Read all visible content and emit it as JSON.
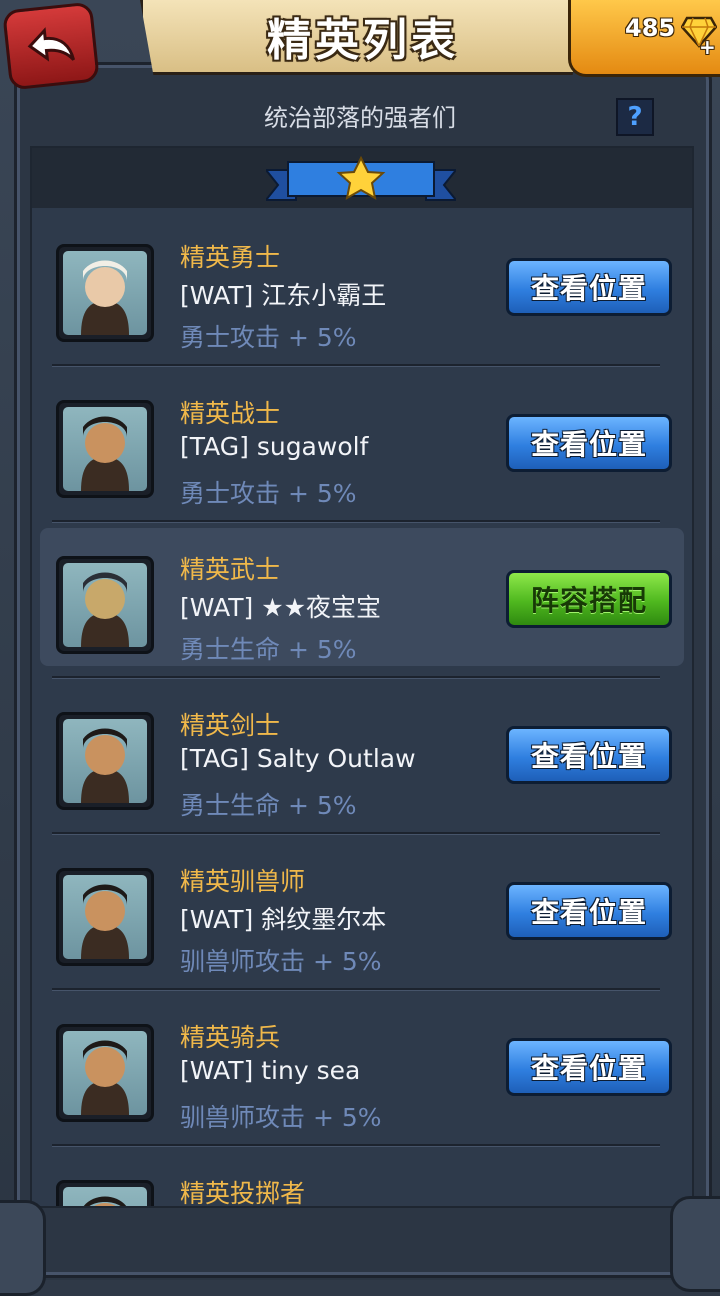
{
  "header": {
    "title": "精英列表",
    "gem_count": "485",
    "back_icon": "back-arrow-icon",
    "gem_icon": "diamond-icon",
    "plus_icon": "plus-icon"
  },
  "subtitle": "统治部落的强者们",
  "help_label": "?",
  "colors": {
    "rank_gold": "#f0b84a",
    "bonus_blue": "#6f89b8",
    "button_blue": "#2f7fe0",
    "button_green": "#4fb81f",
    "back_red": "#c22a2a"
  },
  "elites": [
    {
      "rank": "精英勇士",
      "player": "[WAT] 江东小霸王",
      "bonus": "勇士攻击 + 5%",
      "button": "查看位置",
      "button_style": "blue",
      "active": false
    },
    {
      "rank": "精英战士",
      "player": "[TAG] sugawolf",
      "bonus": "勇士攻击 + 5%",
      "button": "查看位置",
      "button_style": "blue",
      "active": false
    },
    {
      "rank": "精英武士",
      "player": "[WAT] ★★夜宝宝",
      "bonus": "勇士生命 + 5%",
      "button": "阵容搭配",
      "button_style": "green",
      "active": true
    },
    {
      "rank": "精英剑士",
      "player": "[TAG] Salty Outlaw",
      "bonus": "勇士生命 + 5%",
      "button": "查看位置",
      "button_style": "blue",
      "active": false
    },
    {
      "rank": "精英驯兽师",
      "player": "[WAT] 斜纹墨尔本",
      "bonus": "驯兽师攻击 + 5%",
      "button": "查看位置",
      "button_style": "blue",
      "active": false
    },
    {
      "rank": "精英骑兵",
      "player": "[WAT] tiny sea",
      "bonus": "驯兽师攻击 + 5%",
      "button": "查看位置",
      "button_style": "blue",
      "active": false
    },
    {
      "rank": "精英投掷者",
      "player": "",
      "bonus": "",
      "button": "",
      "button_style": "blue",
      "active": false
    }
  ]
}
